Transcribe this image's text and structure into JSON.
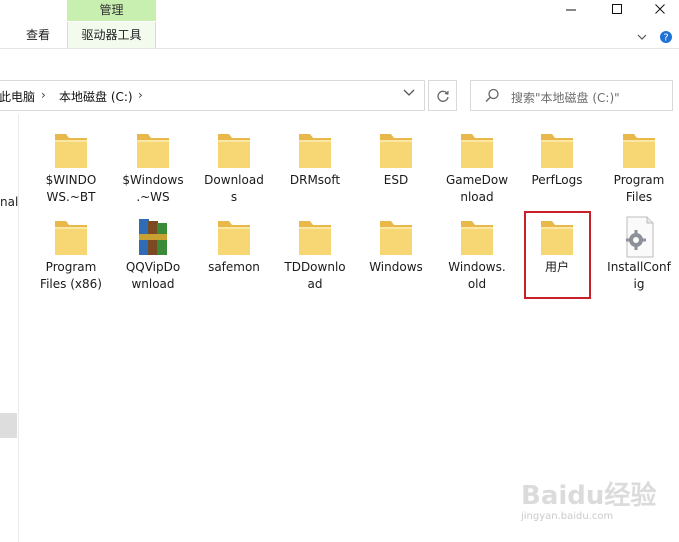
{
  "ribbon": {
    "manage_label": "管理",
    "view_tab": "查看",
    "drive_tools_tab": "驱动器工具"
  },
  "address": {
    "crumbs": [
      "此电脑",
      "本地磁盘 (C:)"
    ],
    "separator": "›"
  },
  "search": {
    "placeholder": "搜索\"本地磁盘 (C:)\""
  },
  "nav": {
    "partial_text": "nal"
  },
  "files": [
    {
      "name": "$WINDO\nWS.~BT",
      "icon": "folder-icon"
    },
    {
      "name": "$Windows\n.~WS",
      "icon": "folder-icon"
    },
    {
      "name": "Download\ns",
      "icon": "folder-icon"
    },
    {
      "name": "DRMsoft",
      "icon": "folder-icon"
    },
    {
      "name": "ESD",
      "icon": "folder-icon"
    },
    {
      "name": "GameDow\nnload",
      "icon": "folder-icon"
    },
    {
      "name": "PerfLogs",
      "icon": "folder-icon"
    },
    {
      "name": "Program\nFiles",
      "icon": "folder-icon"
    },
    {
      "name": "Program\nFiles (x86)",
      "icon": "folder-icon"
    },
    {
      "name": "QQVipDo\nwnload",
      "icon": "archive-icon"
    },
    {
      "name": "safemon",
      "icon": "folder-icon"
    },
    {
      "name": "TDDownlo\nad",
      "icon": "folder-icon"
    },
    {
      "name": "Windows",
      "icon": "folder-icon"
    },
    {
      "name": "Windows.\nold",
      "icon": "folder-icon"
    },
    {
      "name": "用户",
      "icon": "folder-icon"
    },
    {
      "name": "InstallConf\nig",
      "icon": "settings-file-icon"
    }
  ],
  "colors": {
    "folder": "#f7d774",
    "folder_back": "#e8b84a",
    "highlight": "#c8212b",
    "manage_tab": "#c8eeb0"
  },
  "watermark": {
    "text": "Baidu经验",
    "url": "jingyan.baidu.com"
  }
}
